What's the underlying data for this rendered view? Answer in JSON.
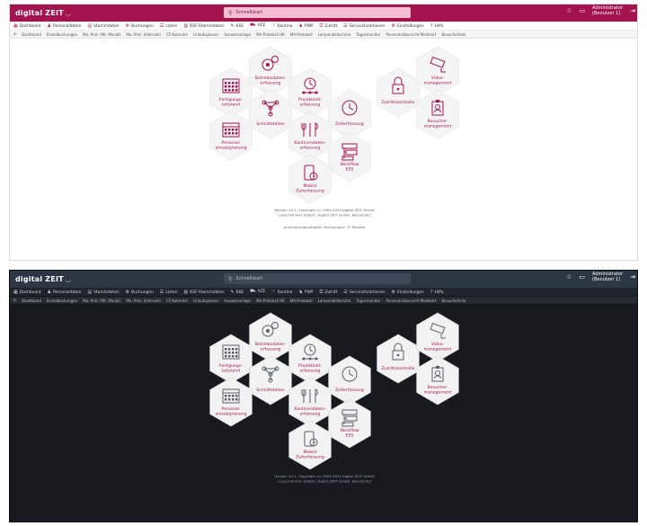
{
  "app": {
    "logo": "digital ZEIT",
    "search_placeholder": "Schnellstart",
    "user_name": "Administrator",
    "user_role": "(Benutzer 1)"
  },
  "colors": {
    "brand": "#a3144f",
    "hex_dark_fill": "#f2f2f2"
  },
  "shots": [
    {
      "theme": "light",
      "menu": [
        {
          "icon": "grid-icon",
          "label": "Dashboard"
        },
        {
          "icon": "person-icon",
          "label": "Personaldaten"
        },
        {
          "icon": "folder-icon",
          "label": "Stammdaten"
        },
        {
          "icon": "gear-icon",
          "label": "Buchungen"
        },
        {
          "icon": "list-icon",
          "label": "Listen"
        },
        {
          "icon": "doc-icon",
          "label": "KSF-Stammdaten"
        },
        {
          "icon": "tool-icon",
          "label": "KSE"
        },
        {
          "icon": "car-icon",
          "label": "AZE"
        },
        {
          "icon": "fork-icon",
          "label": "Kantine"
        },
        {
          "icon": "people-icon",
          "label": "PWP"
        },
        {
          "icon": "lock-icon",
          "label": "Zutritt"
        },
        {
          "icon": "list-icon",
          "label": "Servicefunktionen"
        },
        {
          "icon": "gear-icon",
          "label": "Einstellungen"
        },
        {
          "icon": "help-icon",
          "label": "Hilfe"
        }
      ],
      "tabs": [
        "Dashboard",
        "Einzelbuchungen",
        "Ma.-Prot. (Mt. Monat)",
        "Ma.-Prot. (Intervall)",
        "FZ-Kalender",
        "Urlaubsplaner",
        "Ausweisanlage",
        "MA-Protokoll HR",
        "MA-Protokoll",
        "Lampenbildschirm",
        "Tagesmonitor",
        "Personenübersicht Meldeort",
        "Besucherliste"
      ],
      "hexes": {
        "fertigung": "Fertigungs-\nleitstand",
        "betrieb": "Betriebsdaten-\nerfassung",
        "schnitt": "Schnittstellen",
        "projekt": "Projektzeit-\nerfassung",
        "zeit": "Zeiterfassung",
        "zutritt": "Zutrittskontrolle",
        "video": "Video-\nmanagement",
        "besucher": "Besucher-\nmanagement",
        "personal": "Personal-\neinsatzplanung",
        "kantine": "Kantinendaten-\nerfassung",
        "workflow": "Workflow\nESS",
        "mobile": "Mobile\nZeiterfassung"
      },
      "footer": [
        "Version 14.1, Copyright (c) 1994-2024 digital ZEIT GmbH",
        "Lizenznehmer 00000 | digital ZEIT GmbH, Neustrelitz"
      ],
      "note": "Archivierungsaltdaten: Buchungen: 72 Monate"
    },
    {
      "theme": "dark",
      "menu": [
        {
          "icon": "grid-icon",
          "label": "Dashboard"
        },
        {
          "icon": "person-icon",
          "label": "Personaldaten"
        },
        {
          "icon": "folder-icon",
          "label": "Stammdaten"
        },
        {
          "icon": "gear-icon",
          "label": "Buchungen"
        },
        {
          "icon": "list-icon",
          "label": "Listen"
        },
        {
          "icon": "doc-icon",
          "label": "KSF-Stammdaten"
        },
        {
          "icon": "tool-icon",
          "label": "KSE"
        },
        {
          "icon": "car-icon",
          "label": "AZE"
        },
        {
          "icon": "fork-icon",
          "label": "Kantine"
        },
        {
          "icon": "people-icon",
          "label": "PWP"
        },
        {
          "icon": "lock-icon",
          "label": "Zutritt"
        },
        {
          "icon": "list-icon",
          "label": "Servicefunktionen"
        },
        {
          "icon": "gear-icon",
          "label": "Einstellungen"
        },
        {
          "icon": "help-icon",
          "label": "Hilfe"
        }
      ],
      "tabs": [
        "Dashboard",
        "Einzelbuchungen",
        "Ma.-Prot. (Mt. Monat)",
        "Ma.-Prot. (Intervall)",
        "FZ-Kalender",
        "Urlaubsplaner",
        "Ausweisanlage",
        "MA-Protokoll HR",
        "MA-Protokoll",
        "Lampenbildschirm",
        "Tagesmonitor",
        "Personenübersicht Meldeort",
        "Besucherliste"
      ],
      "hexes": {
        "fertigung": "Fertigungs-\nleitstand",
        "betrieb": "Betriebsdaten-\nerfassung",
        "schnitt": "Schnittstellen",
        "projekt": "Projektzeit-\nerfassung",
        "zeit": "Zeiterfassung",
        "zutritt": "Zutrittskontrolle",
        "video": "Video-\nmanagement",
        "besucher": "Besucher-\nmanagement",
        "personal": "Personal-\neinsatzplanung",
        "kantine": "Kantinendaten-\nerfassung",
        "workflow": "Workflow\nESS",
        "mobile": "Mobile\nZeiterfassung"
      },
      "footer": [
        "Version 14.1, Copyright (c) 1994-2024 digital ZEIT GmbH",
        "Lizenznehmer 00000 | digital ZEIT GmbH, Neustrelitz"
      ]
    }
  ]
}
